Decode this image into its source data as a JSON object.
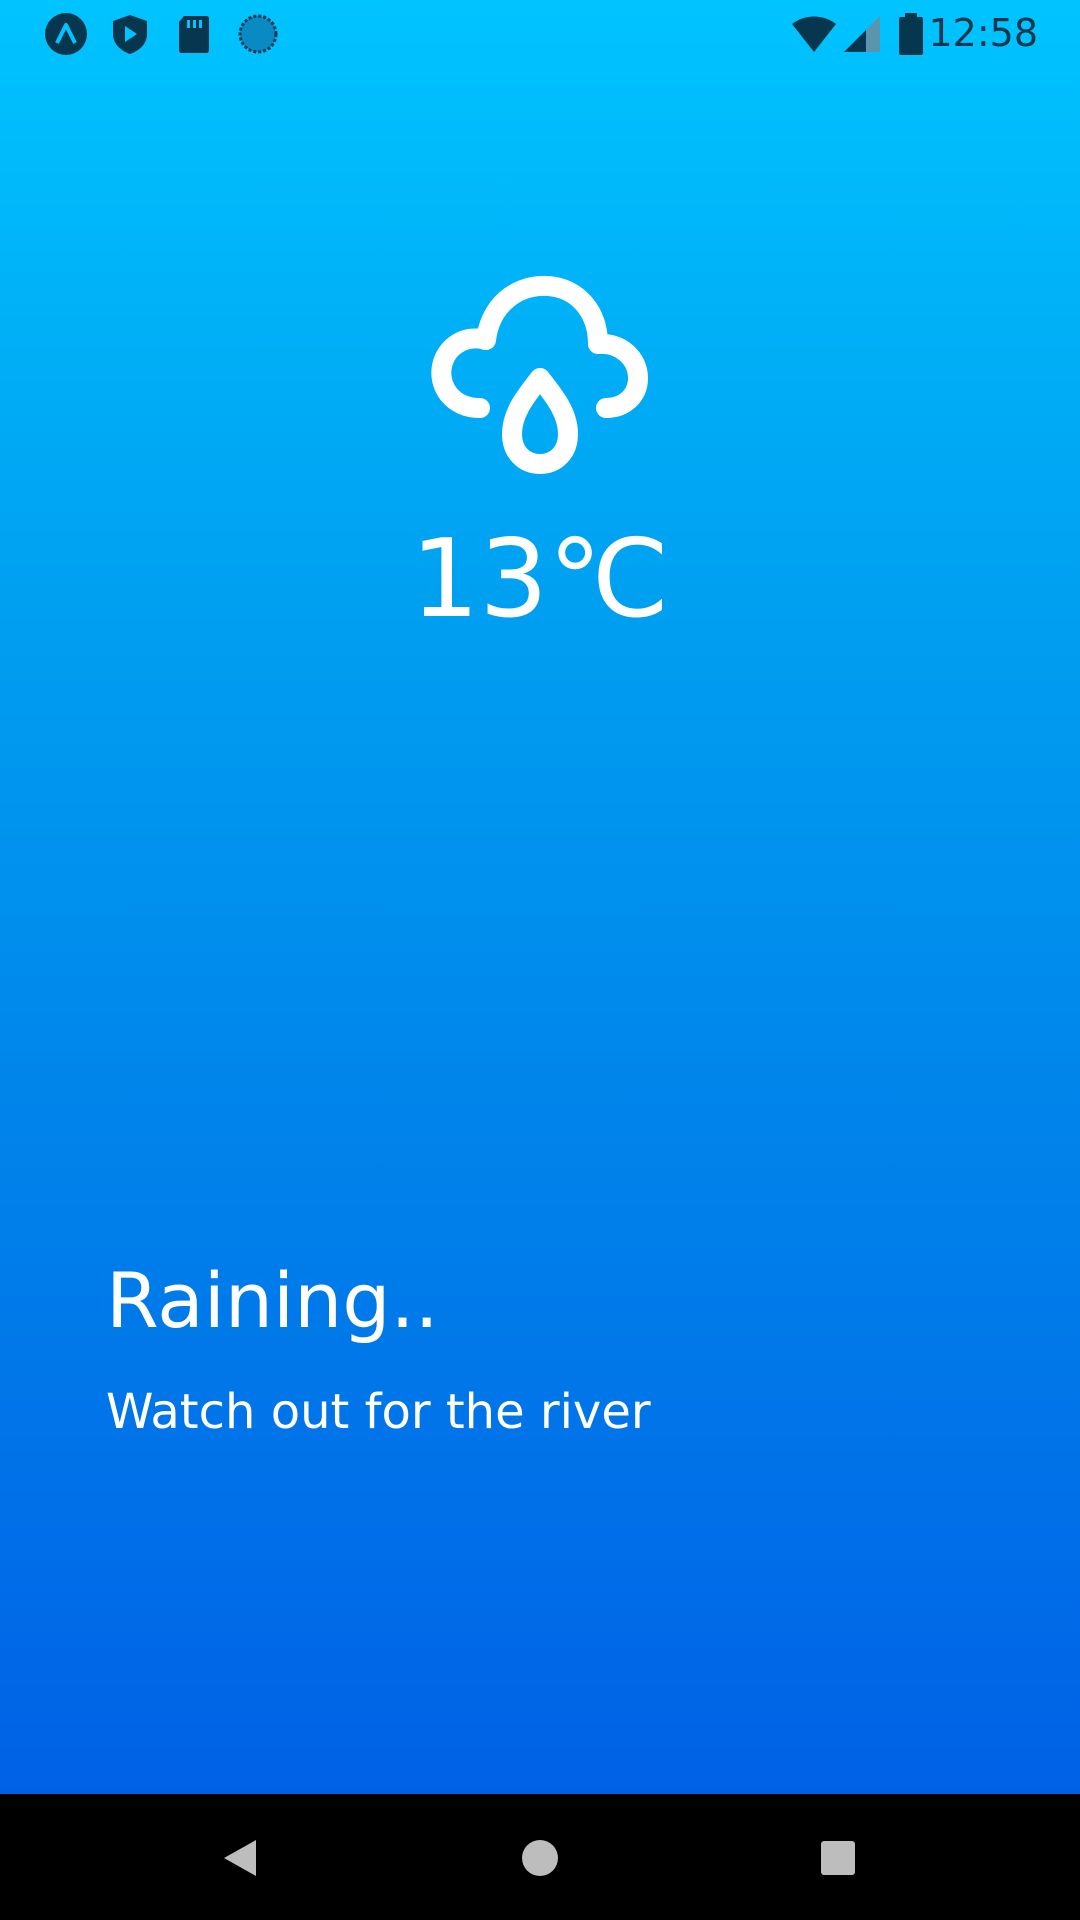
{
  "status_bar": {
    "time": "12:58",
    "left_icons": [
      "expo-icon",
      "play-protect-icon",
      "sd-card-icon",
      "sync-circle-icon"
    ],
    "right_icons": [
      "wifi-icon",
      "cellular-signal-icon",
      "battery-icon"
    ],
    "icon_color": "#06374f"
  },
  "weather": {
    "icon": "cloud-rain-icon",
    "temperature": "13℃",
    "condition": "Raining..",
    "advice": "Watch out for the river"
  },
  "theme": {
    "gradient_top": "#00c4ff",
    "gradient_bottom": "#0061e6",
    "text_color": "#ffffff"
  },
  "nav_bar": {
    "buttons": [
      "back-button",
      "home-button",
      "recents-button"
    ]
  }
}
